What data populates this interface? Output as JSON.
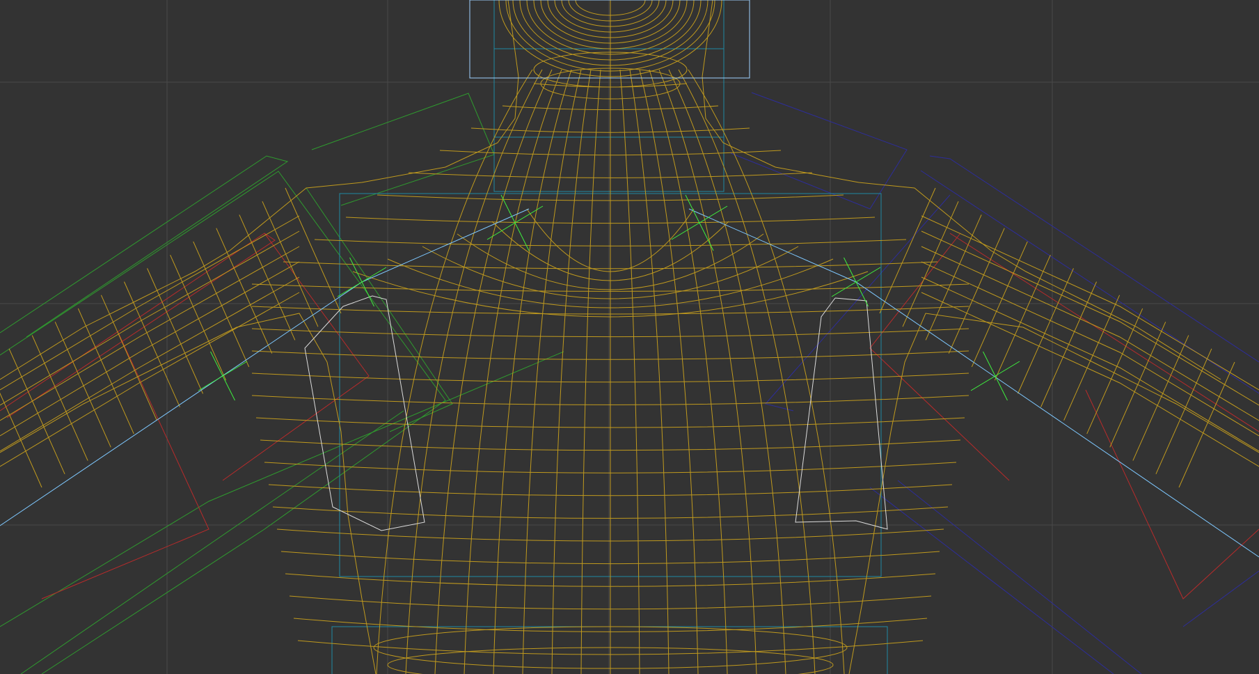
{
  "viewport": {
    "background": "#333333",
    "grid_color": "#4a4a4a"
  },
  "colors": {
    "mesh": "#c09a1e",
    "bone_joint": "#7ec8ff",
    "left_controls": "#2f9b2f",
    "right_controls": "#2d2d9a",
    "bone_bones": "#b82b2b",
    "helper_box": "#1f8aa3",
    "selection": "#dcdcdc",
    "selected_axis": "#3ef03e",
    "frame": "#9fd2ff"
  },
  "icons": {
    "mesh": "wireframe-mesh-icon",
    "bone": "bone-chain-icon",
    "gizmo": "axis-gizmo-icon"
  }
}
